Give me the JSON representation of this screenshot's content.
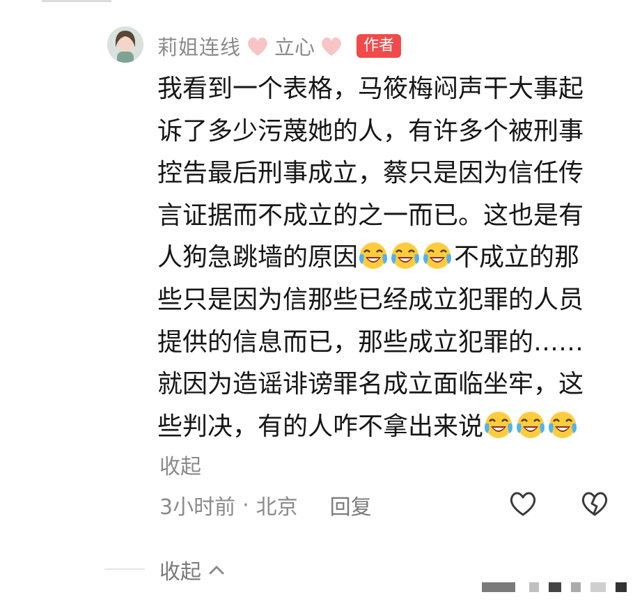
{
  "comment": {
    "username": "莉姐连线",
    "title": "立心",
    "author_badge": "作者",
    "lines": [
      "我看到一个表格，马筱梅闷声干大事起",
      "诉了多少污蔑她的人，有许多个被刑事",
      "控告最后刑事成立，蔡只是因为信任传",
      "言证据而不成立的之一而已。这也是有",
      "人狗急跳墙的原因",
      "不成立的那",
      "些只是因为信那些已经成立犯罪的人员",
      "提供的信息而已，那些成立犯罪的……",
      "就因为造谣诽谤罪名成立面临坐牢，这",
      "些判决，有的人咋不拿出来说"
    ],
    "collapse_label": "收起",
    "time": "3小时前",
    "separator": "·",
    "location": "北京",
    "reply_label": "回复"
  },
  "footer": {
    "collapse_all_label": "收起"
  },
  "icons": {
    "emoji": "laugh-crying-emoji",
    "like": "heart-outline-icon",
    "dislike": "broken-heart-icon",
    "chevron": "chevron-up-icon",
    "title_hearts": "pink-heart-icon"
  },
  "colors": {
    "badge": "#f04a4a",
    "title_heart": "#f7c5c5",
    "muted_text": "#8a8a8a"
  }
}
